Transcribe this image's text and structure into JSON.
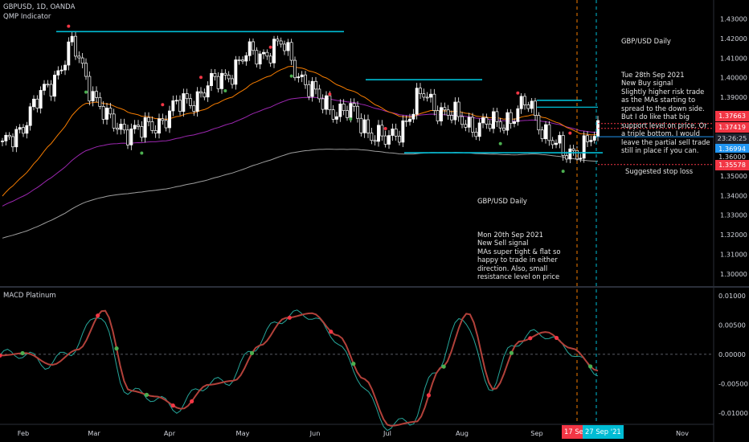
{
  "header": {
    "symbol": "GBPUSD, 1D, OANDA",
    "indicator": "QMP Indicator",
    "macd_title": "MACD Platinum"
  },
  "notes": {
    "top_title": "GBP/USD Daily",
    "top_body": "Tue 28th Sep 2021\nNew Buy signal\nSlightly higher risk trade as the MAs starting to spread to the down side. But I do like that big support level on price. Or a triple bottom. I would leave the partial sell trade still in place if you can.",
    "bottom_title": "GBP/USD Daily",
    "bottom_body": "Mon 20th Sep 2021\nNew Sell signal\nMAs super tight & flat so happy to trade in either direction. Also, small resistance level on price",
    "stop_loss": "Suggested stop loss"
  },
  "price_tags": {
    "upper": "1.37663",
    "middle": "1.37419",
    "countdown": "23:26:25",
    "current": "1.36994",
    "lower": "1.36000",
    "stop": "1.35578"
  },
  "date_tags": {
    "first": "17 Sep",
    "second": "27 Sep '21"
  },
  "colors": {
    "background": "#000000",
    "up_candle": "#ffffff",
    "down_candle": "#ffffff",
    "cyan_level": "#00bcd4",
    "orange_ma": "#f57c00",
    "purple_ma": "#9c27b0",
    "grey_ma": "#9e9e9e",
    "macd_line": "#b2413a",
    "signal_line": "#26a69a",
    "buy_dot": "#4caf50",
    "sell_dot": "#f23645",
    "stop_line": "#f23645",
    "current_price": "#2196f3"
  },
  "chart_data": [
    {
      "type": "candlestick",
      "title": "GBPUSD, 1D, OANDA",
      "x": [
        "Feb",
        "Mar",
        "Apr",
        "May",
        "Jun",
        "Jul",
        "Aug",
        "Sep",
        "Nov"
      ],
      "y_ticks": [
        1.3,
        1.31,
        1.32,
        1.33,
        1.34,
        1.35,
        1.36,
        1.37,
        1.38,
        1.39,
        1.4,
        1.41,
        1.42,
        1.43
      ],
      "ylim": [
        1.2955,
        1.4355
      ],
      "ohlc_anchors_close": [
        {
          "x": "Feb",
          "y": 1.363
        },
        {
          "x": "Feb-mid",
          "y": 1.387
        },
        {
          "x": "Mar",
          "y": 1.416
        },
        {
          "x": "Mar-mid",
          "y": 1.377
        },
        {
          "x": "Apr",
          "y": 1.372
        },
        {
          "x": "Apr-mid",
          "y": 1.385
        },
        {
          "x": "May",
          "y": 1.396
        },
        {
          "x": "May-mid",
          "y": 1.411
        },
        {
          "x": "Jun",
          "y": 1.416
        },
        {
          "x": "Jun-mid",
          "y": 1.388
        },
        {
          "x": "Jul",
          "y": 1.381
        },
        {
          "x": "Jul-mid",
          "y": 1.366
        },
        {
          "x": "Aug",
          "y": 1.391
        },
        {
          "x": "Aug-mid",
          "y": 1.378
        },
        {
          "x": "Sep",
          "y": 1.375
        },
        {
          "x": "Sep-mid",
          "y": 1.386
        },
        {
          "x": "27 Sep '21",
          "y": 1.36
        },
        {
          "x": "28 Sep",
          "y": 1.36994
        }
      ],
      "levels": [
        {
          "name": "resistance-top",
          "y": 1.4235
        },
        {
          "name": "resistance-jul",
          "y": 1.399
        },
        {
          "name": "resistance-sep",
          "y": 1.3885
        },
        {
          "name": "support",
          "y": 1.3618
        }
      ],
      "moving_averages": [
        "orange",
        "purple",
        "grey"
      ],
      "horizontal_markers": [
        {
          "label": "1.37663",
          "y": 1.37663
        },
        {
          "label": "1.37419",
          "y": 1.37419
        },
        {
          "label": "1.36994",
          "y": 1.36994
        },
        {
          "label": "1.35578",
          "y": 1.35578
        }
      ]
    },
    {
      "type": "line",
      "title": "MACD Platinum",
      "y_ticks": [
        -0.01,
        -0.005,
        0.0,
        0.005,
        0.01
      ],
      "ylim": [
        -0.0118,
        0.0108
      ],
      "series": [
        {
          "values": [
            -0.0002,
            0.0002,
            -0.0018,
            0.0008,
            0.0075,
            -0.0062,
            -0.0072,
            -0.0093,
            -0.0052,
            -0.0045,
            0.0015,
            0.0062,
            0.007,
            0.0032,
            -0.0042,
            -0.0122,
            -0.0115,
            -0.0022,
            0.007,
            -0.006,
            0.0022,
            0.0038,
            0.001,
            -0.0028
          ]
        }
      ]
    }
  ]
}
